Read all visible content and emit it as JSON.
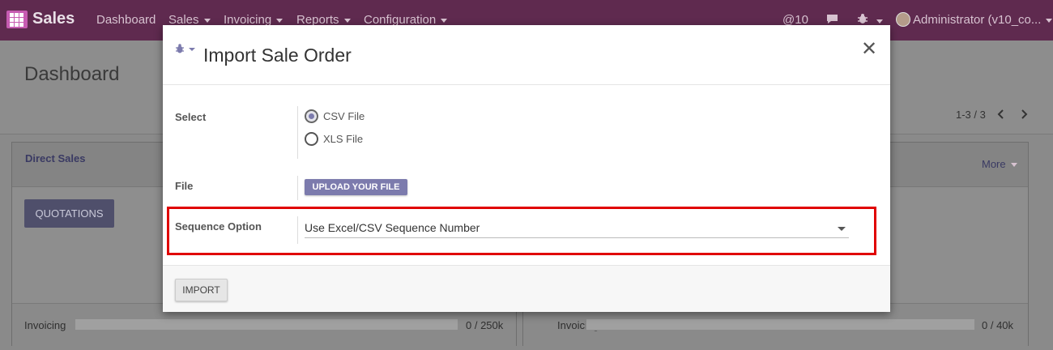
{
  "navbar": {
    "brand": "Sales",
    "menu": [
      "Dashboard",
      "Sales",
      "Invoicing",
      "Reports",
      "Configuration"
    ],
    "mentions": "@10",
    "user": "Administrator (v10_co..."
  },
  "page": {
    "title": "Dashboard",
    "pager": "1-3 / 3",
    "cards": [
      {
        "title": "Direct Sales",
        "button": "QUOTATIONS",
        "progress_label": "Invoicing",
        "progress_value": "0 / 250k",
        "progress_fraction": 0
      },
      {
        "title": "",
        "more": "More",
        "progress_label": "Invoicing",
        "progress_value": "0 / 40k",
        "progress_fraction": 0
      }
    ]
  },
  "modal": {
    "title": "Import Sale Order",
    "select_label": "Select",
    "options": [
      "CSV File",
      "XLS File"
    ],
    "selected_option": "CSV File",
    "file_label": "File",
    "upload_button": "UPLOAD YOUR FILE",
    "sequence_label": "Sequence Option",
    "sequence_value": "Use Excel/CSV Sequence Number",
    "import_button": "IMPORT"
  },
  "colors": {
    "navbar": "#5f2a4f",
    "accent": "#7c7bad",
    "highlight": "#e00000"
  },
  "icons": [
    "apps-grid-icon",
    "chat-icon",
    "bug-icon",
    "close-icon",
    "chevron-left-icon",
    "chevron-right-icon"
  ]
}
